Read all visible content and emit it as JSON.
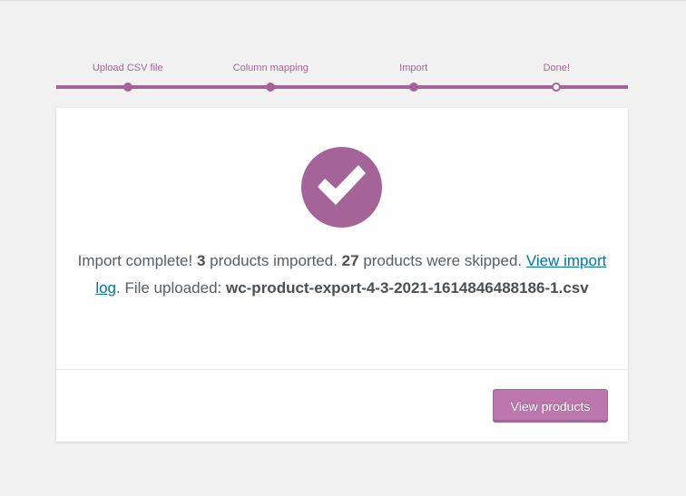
{
  "steps": [
    {
      "label": "Upload CSV file"
    },
    {
      "label": "Column mapping"
    },
    {
      "label": "Import"
    },
    {
      "label": "Done!"
    }
  ],
  "accent_color": "#a46497",
  "button_color": "#bb77ae",
  "link_color": "#0073aa",
  "message": {
    "part1": "Import complete! ",
    "imported_count": "3",
    "part2": " products imported. ",
    "skipped_count": "27",
    "part3": " products were skipped. ",
    "log_link": "View import log",
    "part4": ". File uploaded: ",
    "filename": "wc-product-export-4-3-2021-1614846488186-1.csv"
  },
  "success_icon": "checkmark-circle-icon",
  "actions": {
    "view_products_label": "View products"
  }
}
